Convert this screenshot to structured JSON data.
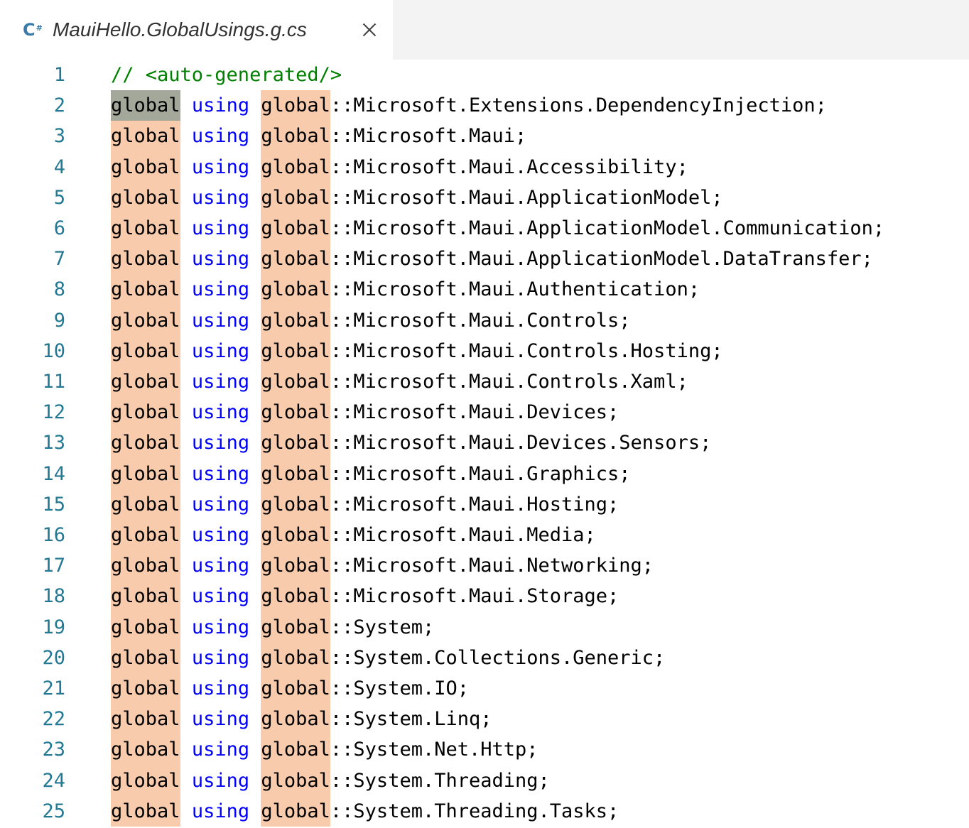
{
  "tab": {
    "icon": "csharp-file-icon",
    "icon_text": "C",
    "icon_sup": "#",
    "title": "MauiHello.GlobalUsings.g.cs",
    "close_icon": "close-icon"
  },
  "colors": {
    "line_number": "#237893",
    "comment": "#008000",
    "keyword_using": "#0000ff",
    "highlight_global": "#f8cbad",
    "highlight_global_current": "#a3a89a",
    "tabbar_background": "#f3f3f3"
  },
  "editor": {
    "header_comment": "// <auto-generated/>",
    "keyword_global": "global",
    "keyword_using": "using",
    "separator": "::",
    "namespaces": [
      "Microsoft.Extensions.DependencyInjection;",
      "Microsoft.Maui;",
      "Microsoft.Maui.Accessibility;",
      "Microsoft.Maui.ApplicationModel;",
      "Microsoft.Maui.ApplicationModel.Communication;",
      "Microsoft.Maui.ApplicationModel.DataTransfer;",
      "Microsoft.Maui.Authentication;",
      "Microsoft.Maui.Controls;",
      "Microsoft.Maui.Controls.Hosting;",
      "Microsoft.Maui.Controls.Xaml;",
      "Microsoft.Maui.Devices;",
      "Microsoft.Maui.Devices.Sensors;",
      "Microsoft.Maui.Graphics;",
      "Microsoft.Maui.Hosting;",
      "Microsoft.Maui.Media;",
      "Microsoft.Maui.Networking;",
      "Microsoft.Maui.Storage;",
      "System;",
      "System.Collections.Generic;",
      "System.IO;",
      "System.Linq;",
      "System.Net.Http;",
      "System.Threading;",
      "System.Threading.Tasks;"
    ],
    "line_numbers": [
      "1",
      "2",
      "3",
      "4",
      "5",
      "6",
      "7",
      "8",
      "9",
      "10",
      "11",
      "12",
      "13",
      "14",
      "15",
      "16",
      "17",
      "18",
      "19",
      "20",
      "21",
      "22",
      "23",
      "24",
      "25"
    ]
  }
}
